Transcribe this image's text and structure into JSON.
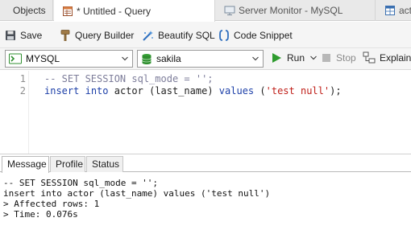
{
  "tabs": {
    "objects": "Objects",
    "query": "* Untitled - Query",
    "monitor": "Server Monitor - MySQL",
    "partial": "act"
  },
  "toolbar": {
    "save": "Save",
    "query_builder": "Query Builder",
    "beautify": "Beautify SQL",
    "code_snippet": "Code Snippet"
  },
  "connection": {
    "name": "MYSQL",
    "database": "sakila",
    "run": "Run",
    "stop": "Stop",
    "explain": "Explain"
  },
  "editor": {
    "line_numbers": [
      "1",
      "2"
    ],
    "line1_comment": "-- SET SESSION sql_mode = '';",
    "line2": {
      "kw1": "insert",
      "kw2": "into",
      "plain1": "actor (last_name)",
      "kw3": "values",
      "open": "(",
      "str": "'test null'",
      "close": ");"
    }
  },
  "result_tabs": [
    "Message",
    "Profile",
    "Status"
  ],
  "messages": [
    "-- SET SESSION sql_mode = '';",
    "insert into actor (last_name) values ('test null')",
    "> Affected rows: 1",
    "> Time: 0.076s"
  ],
  "colors": {
    "keyword": "#1c3fa8",
    "comment": "#7d7d9a",
    "string": "#c0201a",
    "run_green": "#2e9b2e",
    "db_green": "#2f8f2f"
  },
  "icons": [
    "objects-icon",
    "query-icon",
    "monitor-icon",
    "save-icon",
    "query-builder-icon",
    "beautify-icon",
    "code-snippet-icon",
    "connection-icon",
    "database-icon",
    "run-icon",
    "stop-icon",
    "explain-icon",
    "chevron-down-icon"
  ]
}
